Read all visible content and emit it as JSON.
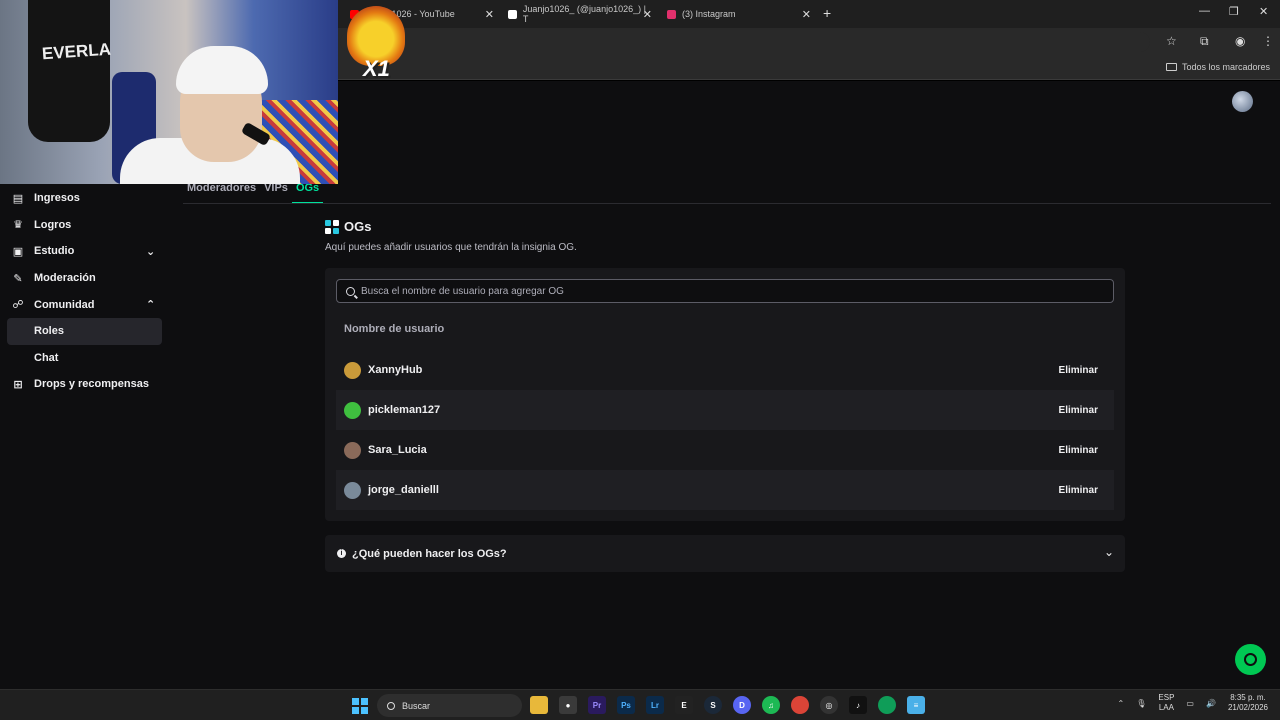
{
  "browser": {
    "tabs": [
      {
        "title": "Juanjo1026 - YouTube",
        "color": "#ff0000"
      },
      {
        "title": "Juanjo1026_ (@juanjo1026_) | T",
        "color": "#ffffff"
      },
      {
        "title": "(3) Instagram",
        "color": "#e1306c"
      }
    ],
    "bookmarks_all": "Todos los marcadores"
  },
  "overlay": {
    "badge_text": "X1",
    "cam_bag_text": "EVERLA"
  },
  "sidebar": {
    "items": [
      {
        "label": "Ingresos",
        "icon": "chart-icon"
      },
      {
        "label": "Logros",
        "icon": "trophy-icon"
      },
      {
        "label": "Estudio",
        "icon": "studio-icon"
      },
      {
        "label": "Moderación",
        "icon": "wrench-icon"
      },
      {
        "label": "Comunidad",
        "icon": "community-icon"
      },
      {
        "label": "Roles"
      },
      {
        "label": "Chat"
      },
      {
        "label": "Drops y recompensas",
        "icon": "gift-icon"
      }
    ]
  },
  "subtabs": [
    "Moderadores",
    "VIPs",
    "OGs"
  ],
  "og": {
    "title": "OGs",
    "description": "Aquí puedes añadir usuarios que tendrán la insignia OG.",
    "search_placeholder": "Busca el nombre de usuario para agregar OG",
    "column_header": "Nombre de usuario",
    "delete_label": "Eliminar",
    "users": [
      {
        "name": "XannyHub",
        "avatar_color": "#c99a3a"
      },
      {
        "name": "pickleman127",
        "avatar_color": "#3fbf3f"
      },
      {
        "name": "Sara_Lucia",
        "avatar_color": "#8a6a5a"
      },
      {
        "name": "jorge_danielll",
        "avatar_color": "#7a8a9a"
      }
    ],
    "faq": "¿Qué pueden hacer los OGs?"
  },
  "taskbar": {
    "search_label": "Buscar",
    "lang_line1": "ESP",
    "lang_line2": "LAA",
    "time": "8:35 p. m.",
    "date": "21/02/2026"
  },
  "colors": {
    "accent": "#00e19c",
    "help_button": "#00c853"
  }
}
